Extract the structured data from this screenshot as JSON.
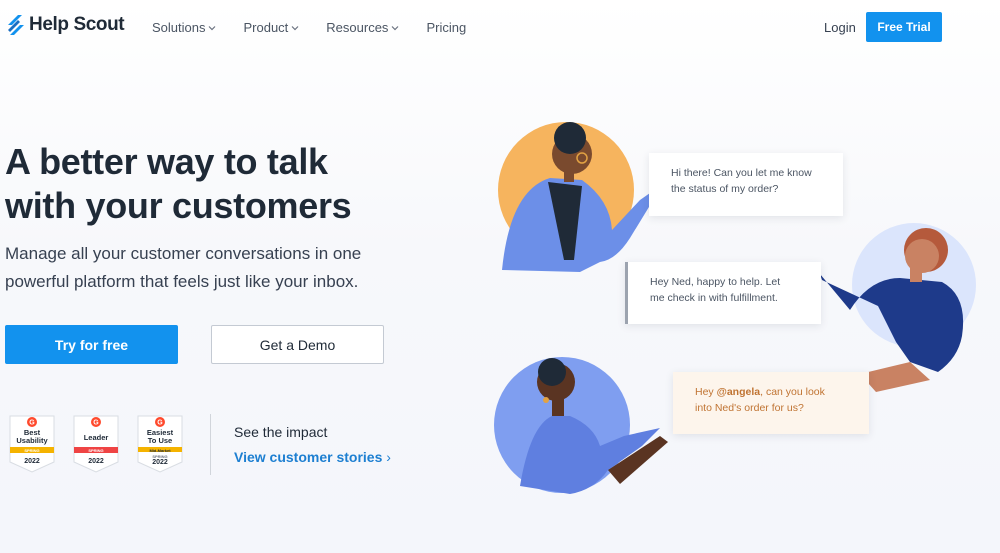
{
  "brand": {
    "name": "Help Scout",
    "accent": "#1292ee",
    "link": "#1d7fd1"
  },
  "nav": {
    "items": [
      {
        "label": "Solutions",
        "has_dropdown": true
      },
      {
        "label": "Product",
        "has_dropdown": true
      },
      {
        "label": "Resources",
        "has_dropdown": true
      },
      {
        "label": "Pricing",
        "has_dropdown": false
      }
    ],
    "login": "Login",
    "cta": "Free Trial"
  },
  "hero": {
    "headline_line1": "A better way to talk",
    "headline_line2": "with your customers",
    "sub_line1": "Manage all your customer conversations in one",
    "sub_line2": "powerful platform that feels just like your inbox.",
    "primary_cta": "Try for free",
    "secondary_cta": "Get a Demo"
  },
  "badges": [
    {
      "title_line1": "Best",
      "title_line2": "Usability",
      "ribbon": "SPRING",
      "ribbon_color": "#f5b300",
      "year": "2022",
      "icon": "g2-logo-icon"
    },
    {
      "title_line1": "Leader",
      "title_line2": "",
      "ribbon": "SPRING",
      "ribbon_color": "#ef4444",
      "year": "2022",
      "icon": "g2-logo-icon"
    },
    {
      "title_line1": "Easiest",
      "title_line2": "To Use",
      "ribbon": "Mid-Market",
      "ribbon_color": "#f5b300",
      "year": "2022",
      "ribbon2": "SPRING",
      "icon": "g2-logo-icon"
    }
  ],
  "impact": {
    "label": "See the impact",
    "link": "View customer stories",
    "link_arrow": "›"
  },
  "conversation": {
    "msg1_line1": "Hi there! Can you let me know",
    "msg1_line2": "the status of my order?",
    "msg2_line1": "Hey Ned, happy to help. Let",
    "msg2_line2": "me check in with fulfillment.",
    "msg3_prefix": "Hey ",
    "msg3_mention": "@angela",
    "msg3_suffix": ", can you look",
    "msg3_line2": "into Ned's order for us?"
  }
}
